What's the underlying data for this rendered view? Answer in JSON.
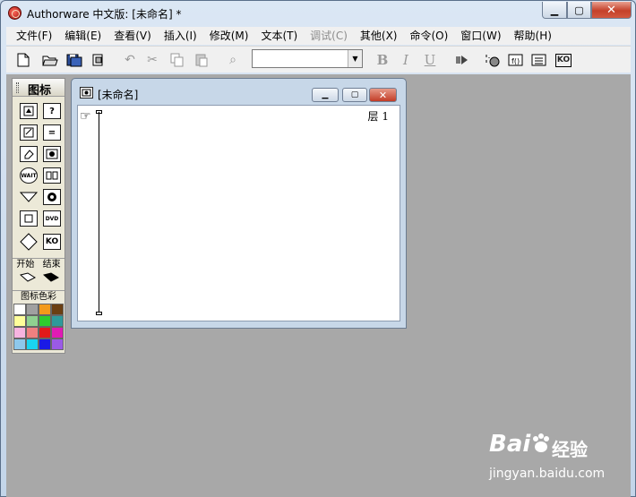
{
  "app": {
    "title": "Authorware 中文版: [未命名] *",
    "min_glyph": "▁",
    "max_glyph": "▢",
    "close_glyph": "✕"
  },
  "menu": [
    {
      "label": "文件(F)",
      "enabled": true
    },
    {
      "label": "编辑(E)",
      "enabled": true
    },
    {
      "label": "查看(V)",
      "enabled": true
    },
    {
      "label": "插入(I)",
      "enabled": true
    },
    {
      "label": "修改(M)",
      "enabled": true
    },
    {
      "label": "文本(T)",
      "enabled": true
    },
    {
      "label": "调试(C)",
      "enabled": false
    },
    {
      "label": "其他(X)",
      "enabled": true
    },
    {
      "label": "命令(O)",
      "enabled": true
    },
    {
      "label": "窗口(W)",
      "enabled": true
    },
    {
      "label": "帮助(H)",
      "enabled": true
    }
  ],
  "toolbar": {
    "font_combo_value": "",
    "bold": "B",
    "italic": "I",
    "underline": "U",
    "ko": "KO"
  },
  "palette": {
    "title": "图标",
    "start_label": "开始",
    "end_label": "结束",
    "color_label": "图标色彩",
    "wait_text": "WAIT",
    "dvd_text": "DVD",
    "ko_text": "KO",
    "swatches": [
      "#ffffff",
      "#a0a0a0",
      "#f39a1a",
      "#6b3f12",
      "#fefe9a",
      "#90d090",
      "#2ecc2e",
      "#2e9a9a",
      "#f7b4e0",
      "#f08080",
      "#e21a1a",
      "#e01ab4",
      "#8ec8ec",
      "#1ad4f0",
      "#1a1ae6",
      "#9a5ae6"
    ]
  },
  "child": {
    "title": "[未命名]",
    "layer_label": "层 1"
  },
  "watermark": {
    "logo": "Bai",
    "sub": "经验",
    "url": "jingyan.baidu.com"
  }
}
